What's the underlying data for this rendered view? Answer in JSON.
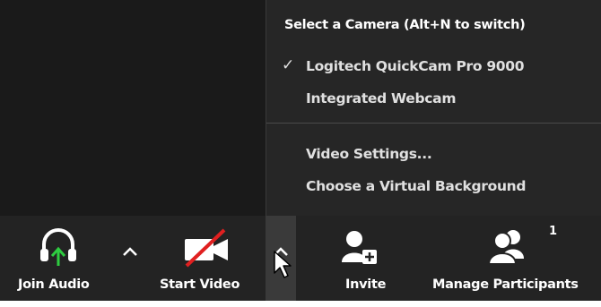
{
  "camera_menu": {
    "header": "Select a Camera (Alt+N to switch)",
    "cameras": [
      {
        "label": "Logitech QuickCam Pro 9000",
        "selected": true
      },
      {
        "label": "Integrated Webcam",
        "selected": false
      }
    ],
    "options": [
      {
        "label": "Video Settings..."
      },
      {
        "label": "Choose a Virtual Background"
      }
    ],
    "check_glyph": "✓"
  },
  "toolbar": {
    "join_audio_label": "Join Audio",
    "start_video_label": "Start Video",
    "invite_label": "Invite",
    "manage_participants_label": "Manage Participants",
    "participant_count": "1"
  },
  "colors": {
    "accent_green": "#2ecc40",
    "muted_red": "#e02020",
    "background": "#1a1a1a",
    "toolbar": "#232323",
    "menu": "#262626"
  },
  "icons": {
    "join_audio": "headphones-icon",
    "audio_arrow": "arrow-up-icon",
    "start_video": "video-camera-off-icon",
    "invite": "person-add-icon",
    "participants": "participants-icon",
    "chevron": "chevron-up-icon",
    "cursor": "mouse-pointer-icon"
  }
}
